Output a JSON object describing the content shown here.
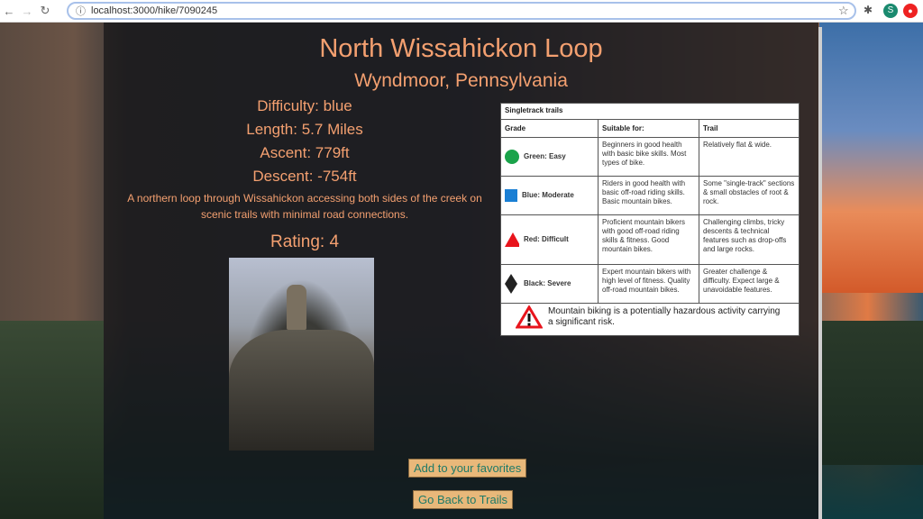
{
  "browser": {
    "url": "localhost:3000/hike/7090245",
    "profile_initial": "S"
  },
  "hike": {
    "title": "North Wissahickon Loop",
    "location": "Wyndmoor, Pennsylvania",
    "difficulty": "Difficulty: blue",
    "length": "Length: 5.7 Miles",
    "ascent": "Ascent: 779ft",
    "descent": "Descent: -754ft",
    "summary": "A northern loop through Wissahickon accessing both sides of the creek on scenic trails with minimal road connections.",
    "rating": "Rating: 4"
  },
  "buttons": {
    "favorite": "Add to your favorites",
    "back": "Go Back to Trails"
  },
  "legend": {
    "title": "Singletrack trails",
    "headers": [
      "Grade",
      "Suitable for:",
      "Trail"
    ],
    "rows": [
      {
        "grade": "Green: Easy",
        "color": "#1aa34a",
        "shape": "circle",
        "suitable": "Beginners in good health with basic bike skills. Most types of bike.",
        "trail": "Relatively flat & wide."
      },
      {
        "grade": "Blue: Moderate",
        "color": "#1a7fd4",
        "shape": "square",
        "suitable": "Riders in good health with basic off-road riding skills. Basic mountain bikes.",
        "trail": "Some \"single-track\" sections & small obstacles of root & rock."
      },
      {
        "grade": "Red: Difficult",
        "color": "#e8141c",
        "shape": "triangle",
        "suitable": "Proficient mountain bikers with good off-road riding skills & fitness. Good mountain bikes.",
        "trail": "Challenging climbs, tricky descents & technical features such as drop-offs and large rocks."
      },
      {
        "grade": "Black: Severe",
        "color": "#222222",
        "shape": "diamond",
        "suitable": "Expert mountain bikers with high level of fitness. Quality off-road mountain bikes.",
        "trail": "Greater challenge & difficulty. Expect large & unavoidable features."
      }
    ],
    "warning": "Mountain biking is a potentially hazardous activity carrying a significant risk."
  }
}
